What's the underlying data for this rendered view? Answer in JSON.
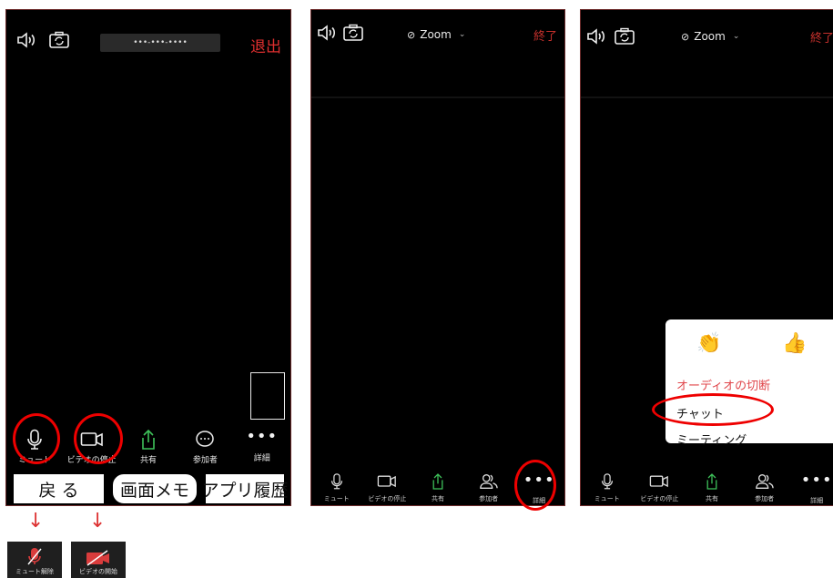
{
  "panel1": {
    "meeting_id": "•••-•••-••••",
    "end_label": "退出",
    "toolbar": [
      "ミュート",
      "ビデオの停止",
      "共有",
      "参加者",
      "詳細"
    ],
    "nav": [
      "戻 る",
      "画面メモ",
      "アプリ履歴"
    ],
    "mic_muted_label": "ミュート解除",
    "video_start_label": "ビデオの開始"
  },
  "panel2": {
    "title": "Zoom",
    "end_label": "終了",
    "toolbar": [
      "ミュート",
      "ビデオの停止",
      "共有",
      "参加者",
      "詳細"
    ]
  },
  "panel3": {
    "title": "Zoom",
    "end_label": "終了",
    "toolbar": [
      "ミュート",
      "ビデオの停止",
      "共有",
      "参加者",
      "詳細"
    ],
    "menu": {
      "reactions": [
        "👏",
        "👍"
      ],
      "disconnect_audio": "オーディオの切断",
      "chat": "チャット",
      "meeting": "ミーティング"
    }
  },
  "colors": {
    "end_red": "#e02f2f",
    "share_green": "#3ec25a",
    "annotation_red": "#e00000"
  }
}
